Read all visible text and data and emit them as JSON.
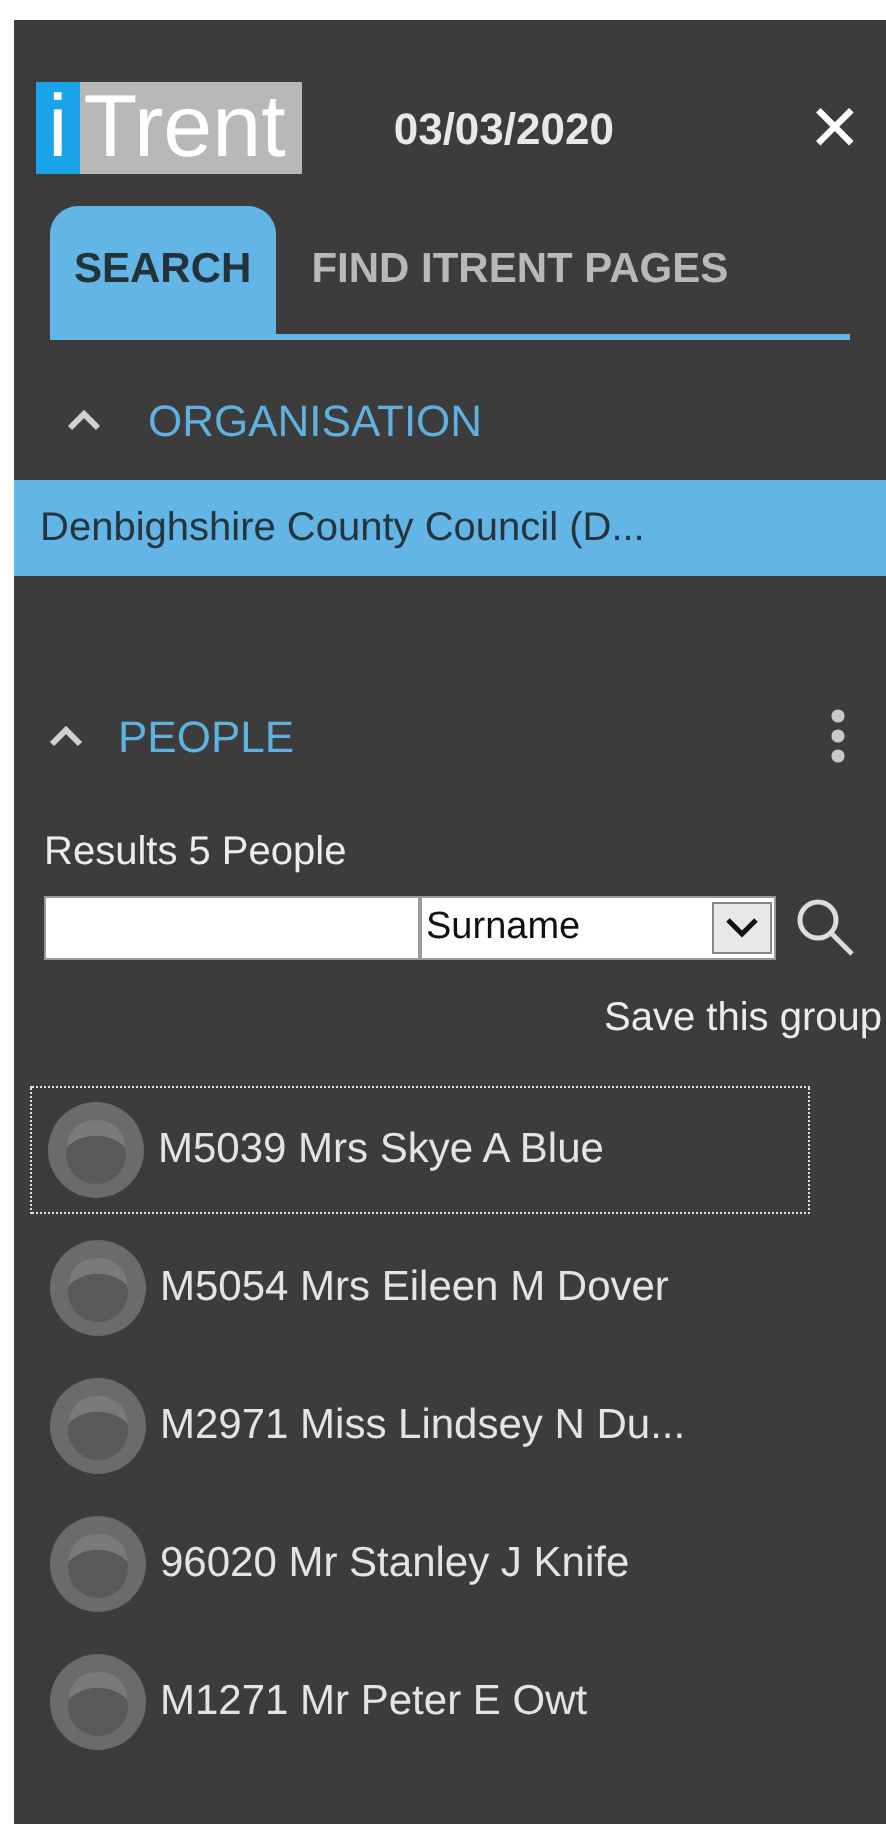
{
  "header": {
    "logo_letter": "i",
    "logo_word": "Trent",
    "date": "03/03/2020",
    "close": "✕"
  },
  "tabs": [
    {
      "label": "SEARCH",
      "selected": true
    },
    {
      "label": "FIND ITRENT PAGES",
      "selected": false
    }
  ],
  "organisation": {
    "title": "ORGANISATION",
    "expanded": true,
    "items": [
      {
        "label": "Denbighshire County Council (D...",
        "selected": true
      }
    ]
  },
  "people": {
    "title": "PEOPLE",
    "expanded": true,
    "results": "Results 5 People",
    "search_by": "Surname",
    "save_link": "Save this group",
    "items": [
      {
        "label": "M5039 Mrs Skye A Blue",
        "focused": true
      },
      {
        "label": "M5054 Mrs Eileen M Dover",
        "focused": false
      },
      {
        "label": "M2971 Miss Lindsey N Du...",
        "focused": false
      },
      {
        "label": "96020 Mr Stanley J Knife",
        "focused": false
      },
      {
        "label": "M1271 Mr Peter E Owt",
        "focused": false
      }
    ]
  }
}
